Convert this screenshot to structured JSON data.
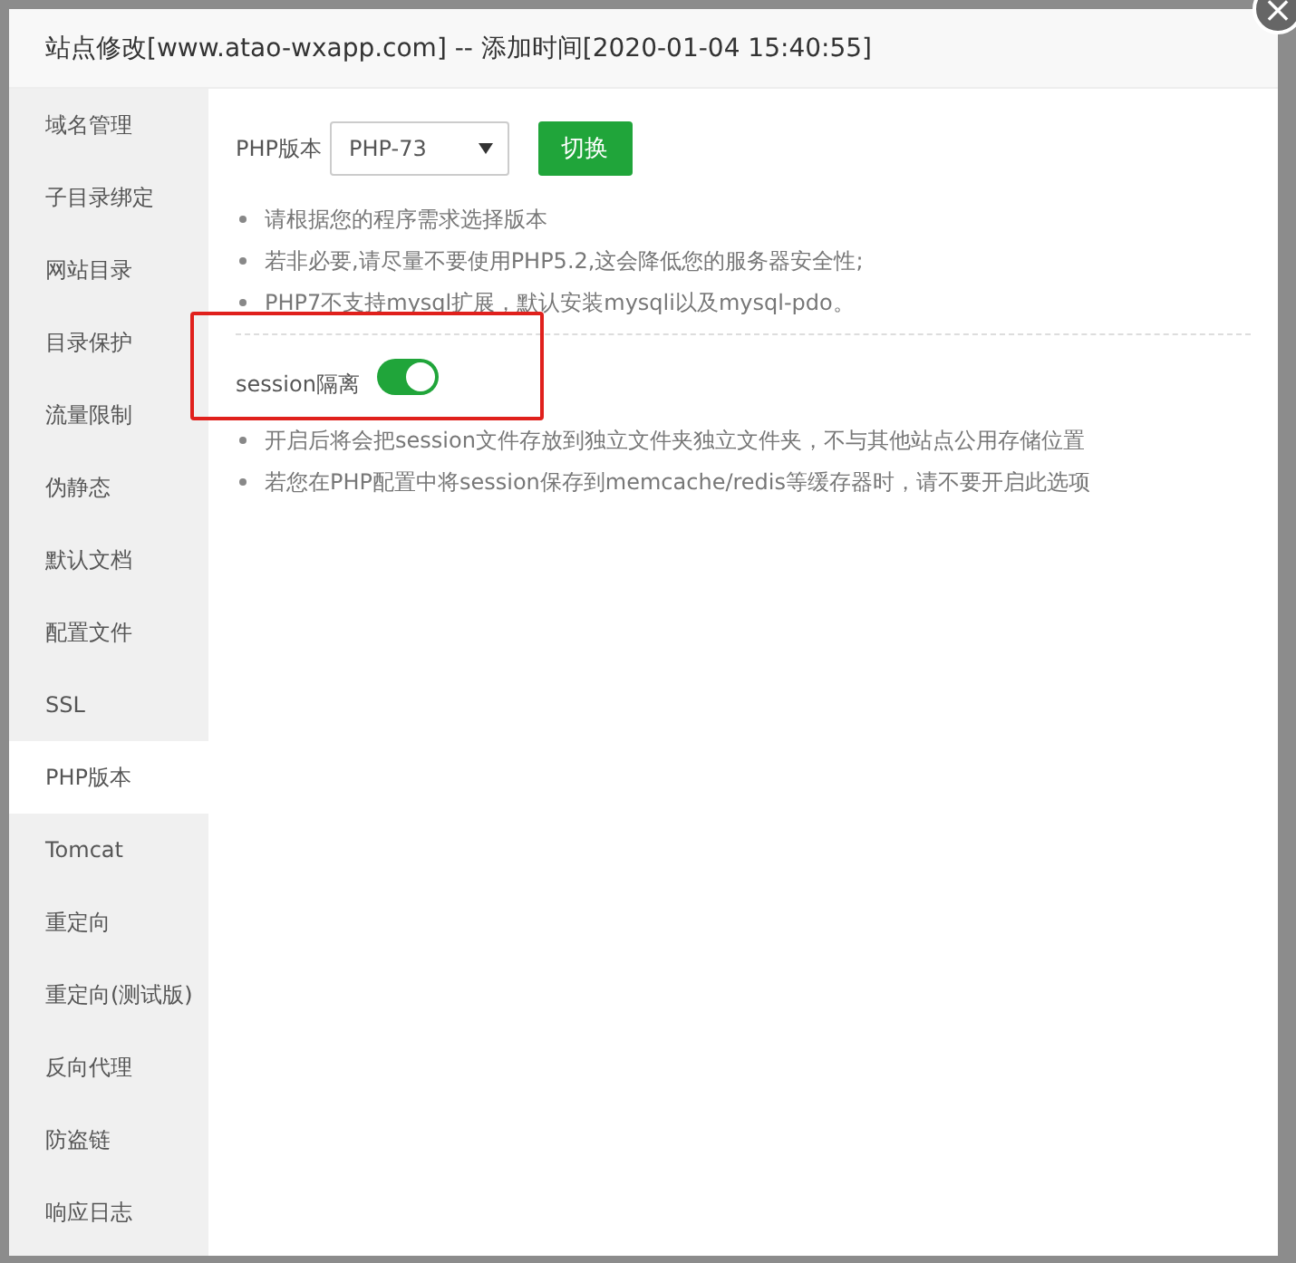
{
  "dialog": {
    "title": "站点修改[www.atao-wxapp.com] -- 添加时间[2020-01-04 15:40:55]",
    "close_icon": "×"
  },
  "sidebar": {
    "items": [
      {
        "label": "域名管理",
        "selected": false
      },
      {
        "label": "子目录绑定",
        "selected": false
      },
      {
        "label": "网站目录",
        "selected": false
      },
      {
        "label": "目录保护",
        "selected": false
      },
      {
        "label": "流量限制",
        "selected": false
      },
      {
        "label": "伪静态",
        "selected": false
      },
      {
        "label": "默认文档",
        "selected": false
      },
      {
        "label": "配置文件",
        "selected": false
      },
      {
        "label": "SSL",
        "selected": false
      },
      {
        "label": "PHP版本",
        "selected": true
      },
      {
        "label": "Tomcat",
        "selected": false
      },
      {
        "label": "重定向",
        "selected": false
      },
      {
        "label": "重定向(测试版)",
        "selected": false
      },
      {
        "label": "反向代理",
        "selected": false
      },
      {
        "label": "防盗链",
        "selected": false
      },
      {
        "label": "响应日志",
        "selected": false
      }
    ]
  },
  "php_version": {
    "label": "PHP版本",
    "select": {
      "value": "PHP-73"
    },
    "button": "切换",
    "notes": [
      "请根据您的程序需求选择版本",
      "若非必要,请尽量不要使用PHP5.2,这会降低您的服务器安全性;",
      "PHP7不支持mysql扩展，默认安装mysqli以及mysql-pdo。"
    ]
  },
  "session_isolation": {
    "label": "session隔离",
    "on": true,
    "notes": [
      "开启后将会把session文件存放到独立文件夹独立文件夹，不与其他站点公用存储位置",
      "若您在PHP配置中将session保存到memcache/redis等缓存器时，请不要开启此选项"
    ]
  }
}
